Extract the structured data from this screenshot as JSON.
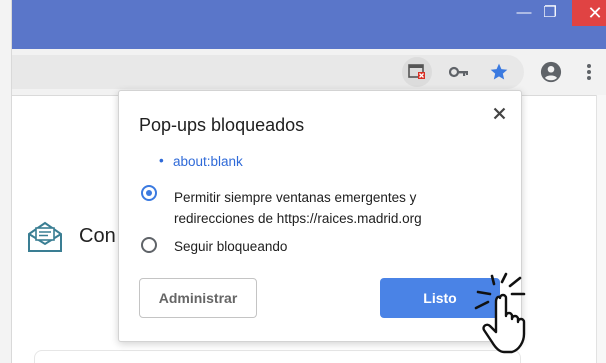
{
  "window": {
    "minimize_glyph": "—",
    "maximize_glyph": "❐",
    "close_glyph": "✕",
    "frame_color": "#5a76c9",
    "close_color": "#e04343"
  },
  "toolbar": {
    "icons": [
      "popup-blocked-icon",
      "key-icon",
      "star-icon",
      "account-icon",
      "menu-icon"
    ],
    "star_color": "#3b7ae0"
  },
  "background": {
    "partial_text": "Con"
  },
  "dialog": {
    "title": "Pop-ups bloqueados",
    "close_glyph": "✕",
    "blocked_bullet": "•",
    "blocked_url": "about:blank",
    "options": [
      {
        "label": "Permitir siempre ventanas emergentes y redirecciones de https://raices.madrid.org",
        "selected": true
      },
      {
        "label": "Seguir bloqueando",
        "selected": false
      }
    ],
    "manage_button": "Administrar",
    "done_button": "Listo",
    "accent": "#4a83e6",
    "link_color": "#2f6ad8"
  }
}
